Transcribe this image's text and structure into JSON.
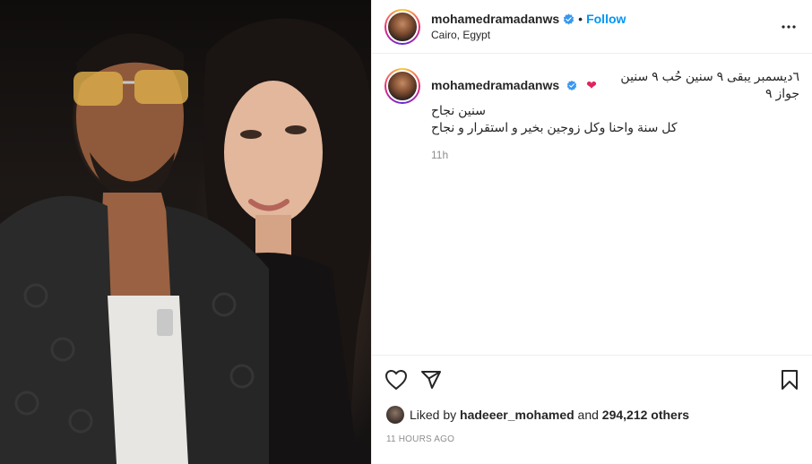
{
  "header": {
    "username": "mohamedramadanws",
    "separator": "•",
    "follow_label": "Follow",
    "location": "Cairo, Egypt"
  },
  "caption": {
    "username": "mohamedramadanws",
    "text_line1": "٦ديسمبر يبقى ٩ سنين حُب ٩ سنين جواز ٩",
    "text_line2": "سنين نجاح",
    "text_line3": "كل سنة واحنا وكل زوجين بخير و استقرار و نجاح",
    "heart": "❤",
    "time": "11h"
  },
  "likes": {
    "prefix": "Liked by",
    "user": "hadeeer_mohamed",
    "conjunction": "and",
    "others": "294,212 others"
  },
  "posted": "11 HOURS AGO",
  "icons": {
    "more": "more-options-icon",
    "like": "heart-icon",
    "share": "share-icon",
    "save": "bookmark-icon",
    "verified": "verified-badge-icon"
  },
  "colors": {
    "accent": "#0095f6",
    "muted": "#8e8e8e",
    "heart": "#e0245e"
  }
}
